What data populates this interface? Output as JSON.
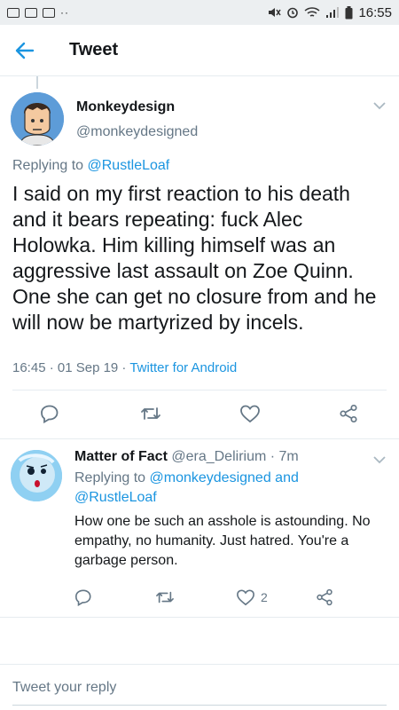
{
  "status_bar": {
    "time": "16:55",
    "left_dots": "··"
  },
  "header": {
    "title": "Tweet"
  },
  "main_tweet": {
    "display_name": "Monkeydesign",
    "handle": "@monkeydesigned",
    "replying_prefix": "Replying to",
    "replying_to": "@RustleLoaf",
    "text": "I said on my first reaction to his death and it bears repeating: fuck Alec Holowka. Him killing himself was an aggressive last assault on Zoe Quinn. One she can get no closure from and he will now be martyrized by incels.",
    "timestamp": "16:45 · 01 Sep 19 · ",
    "client": "Twitter for Android"
  },
  "reply_tweet": {
    "display_name": "Matter of Fact",
    "handle": "@era_Delirium",
    "age": "· 7m",
    "replying_prefix": "Replying to",
    "replying_to_1": "@monkeydesigned",
    "and": "and",
    "replying_to_2": "@RustleLoaf",
    "text": "How one be such an asshole is astounding. No empathy, no humanity. Just hatred. You're a garbage person.",
    "like_count": "2"
  },
  "compose": {
    "placeholder": "Tweet your reply"
  },
  "colors": {
    "link": "#1b95e0",
    "secondary_text": "#657786",
    "divider": "#e6ecf0"
  }
}
